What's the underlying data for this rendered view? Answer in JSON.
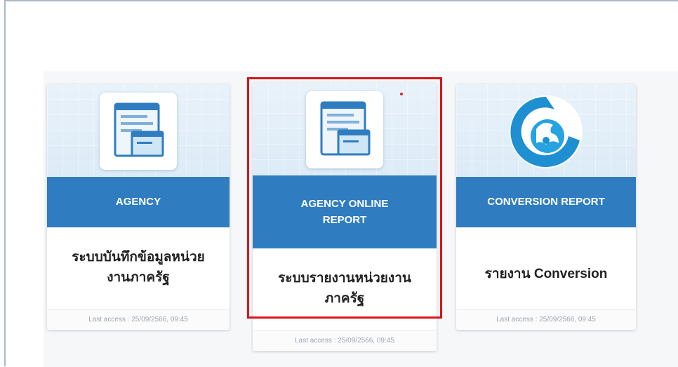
{
  "cards": [
    {
      "title": "AGENCY",
      "description": "ระบบบันทึกข้อมูลหน่วยงานภาครัฐ",
      "last_access": "Last access : 25/09/2566, 09:45",
      "icon": "document-window-icon"
    },
    {
      "title": "AGENCY ONLINE REPORT",
      "description": "ระบบรายงานหน่วยงานภาครัฐ",
      "last_access": "Last access : 25/09/2566, 09:45",
      "icon": "document-window-icon",
      "highlighted": true
    },
    {
      "title": "CONVERSION REPORT",
      "description": "รายงาน Conversion",
      "last_access": "Last access : 25/09/2566, 09:45",
      "icon": "bank-logo-icon"
    }
  ],
  "colors": {
    "banner": "#2f7dc0",
    "highlight": "#d9151b",
    "card_header_bg": "#dcebf7"
  }
}
